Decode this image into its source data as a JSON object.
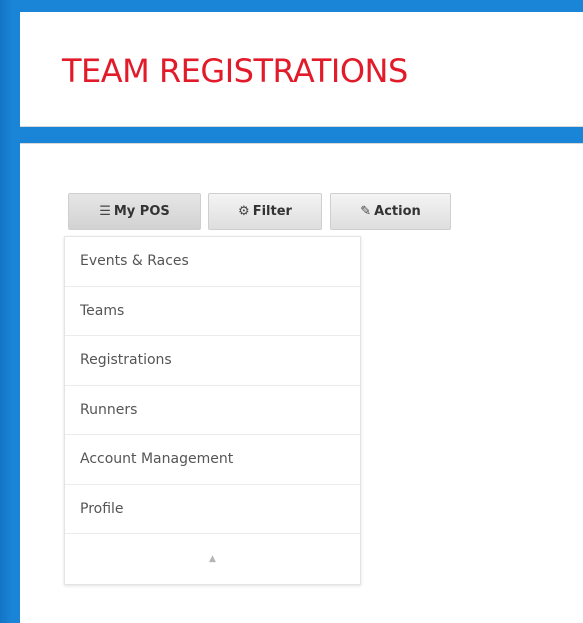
{
  "header": {
    "title": "TEAM REGISTRATIONS"
  },
  "toolbar": {
    "mypos": {
      "label": "My POS",
      "icon": "list-icon"
    },
    "filter": {
      "label": "Filter",
      "icon": "gear-icon"
    },
    "action": {
      "label": "Action",
      "icon": "pencil-icon"
    }
  },
  "menu": {
    "items": [
      {
        "label": "Events & Races"
      },
      {
        "label": "Teams"
      },
      {
        "label": "Registrations"
      },
      {
        "label": "Runners"
      },
      {
        "label": "Account Management"
      },
      {
        "label": "Profile"
      }
    ],
    "collapse_icon": "caret-up-icon"
  },
  "colors": {
    "title": "#e21b2a",
    "background": "#1a84d6"
  }
}
